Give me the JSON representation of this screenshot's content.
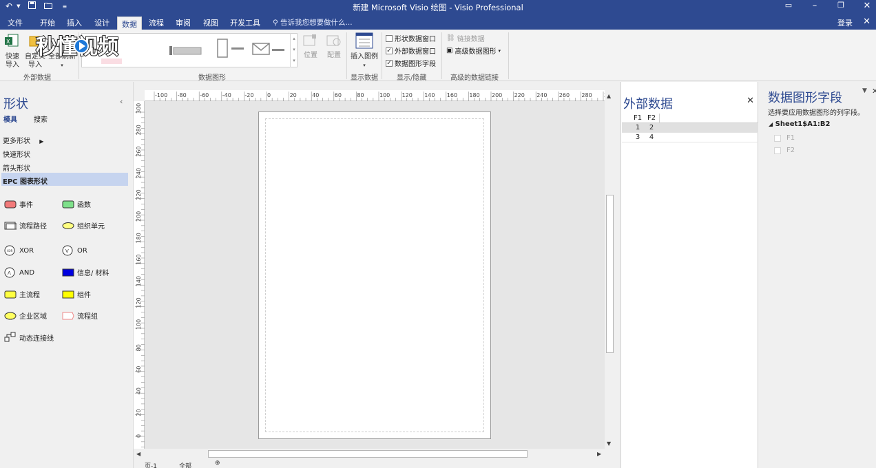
{
  "window": {
    "title": "新建 Microsoft Visio 绘图 - Visio Professional",
    "login": "登录"
  },
  "tabs": [
    "文件",
    "开始",
    "插入",
    "设计",
    "数据",
    "流程",
    "审阅",
    "视图",
    "开发工具"
  ],
  "active_tab": "数据",
  "tell_me": "告诉我您想要做什么...",
  "ribbon": {
    "external_data": {
      "label": "外部数据",
      "quick_import": "快速导入",
      "custom_import": "自定义导入",
      "refresh_all": "全部刷新"
    },
    "data_graphics": {
      "label": "数据图形",
      "position": "位置",
      "config": "配置"
    },
    "show_data": {
      "label": "显示数据",
      "insert_legend": "插入图例"
    },
    "show_hide": {
      "label": "显示/隐藏",
      "shape_data_window": "形状数据窗口",
      "external_data_window": "外部数据窗口",
      "data_graphic_fields": "数据图形字段",
      "checks": [
        false,
        true,
        true
      ]
    },
    "advanced": {
      "label": "高级的数据链接",
      "link_data": "链接数据",
      "advanced_data_graphics": "高级数据图形"
    }
  },
  "watermark": "秒懂视频",
  "shapes_panel": {
    "title": "形状",
    "tabs": [
      "模具",
      "搜索"
    ],
    "items": [
      "更多形状",
      "快速形状",
      "箭头形状"
    ],
    "selected": "EPC 图表形状",
    "stencil": [
      {
        "label": "事件",
        "icon": "event-icon",
        "color": "#f27a7a"
      },
      {
        "label": "函数",
        "icon": "function-icon",
        "color": "#7ee08a"
      },
      {
        "label": "流程路径",
        "icon": "process-path-icon",
        "color": "#ffffff"
      },
      {
        "label": "组织单元",
        "icon": "org-unit-icon",
        "color": "#ffff80"
      },
      {
        "label": "XOR",
        "icon": "xor-icon",
        "color": "#ffffff"
      },
      {
        "label": "OR",
        "icon": "or-icon",
        "color": "#ffffff"
      },
      {
        "label": "AND",
        "icon": "and-icon",
        "color": "#ffffff"
      },
      {
        "label": "信息/ 材料",
        "icon": "info-material-icon",
        "color": "#0000e0"
      },
      {
        "label": "主流程",
        "icon": "main-process-icon",
        "color": "#ffff40"
      },
      {
        "label": "组件",
        "icon": "component-icon",
        "color": "#ffff00"
      },
      {
        "label": "企业区域",
        "icon": "enterprise-area-icon",
        "color": "#ffff60"
      },
      {
        "label": "流程组",
        "icon": "process-group-icon",
        "color": "#ffffff"
      },
      {
        "label": "动态连接线",
        "icon": "dynamic-connector-icon",
        "color": "#ffffff"
      }
    ]
  },
  "ruler": {
    "h_ticks": [
      "-100",
      "-80",
      "-60",
      "-40",
      "-20",
      "0",
      "20",
      "40",
      "60",
      "80",
      "100",
      "120",
      "140",
      "160",
      "180",
      "200",
      "220",
      "240",
      "260",
      "280",
      "300"
    ],
    "v_ticks": [
      "300",
      "280",
      "260",
      "240",
      "220",
      "200",
      "180",
      "160",
      "140",
      "120",
      "100",
      "80",
      "60",
      "40",
      "20",
      "0"
    ]
  },
  "page_tabs": [
    "页-1",
    "全部"
  ],
  "external_data_panel": {
    "title": "外部数据",
    "columns": [
      "F1",
      "F2"
    ],
    "rows": [
      [
        "1",
        "2"
      ],
      [
        "3",
        "4"
      ]
    ]
  },
  "data_graphic_fields_panel": {
    "title": "数据图形字段",
    "subtitle": "选择要应用数据图形的列字段。",
    "sheet": "Sheet1$A1:B2",
    "fields": [
      "F1",
      "F2"
    ]
  }
}
